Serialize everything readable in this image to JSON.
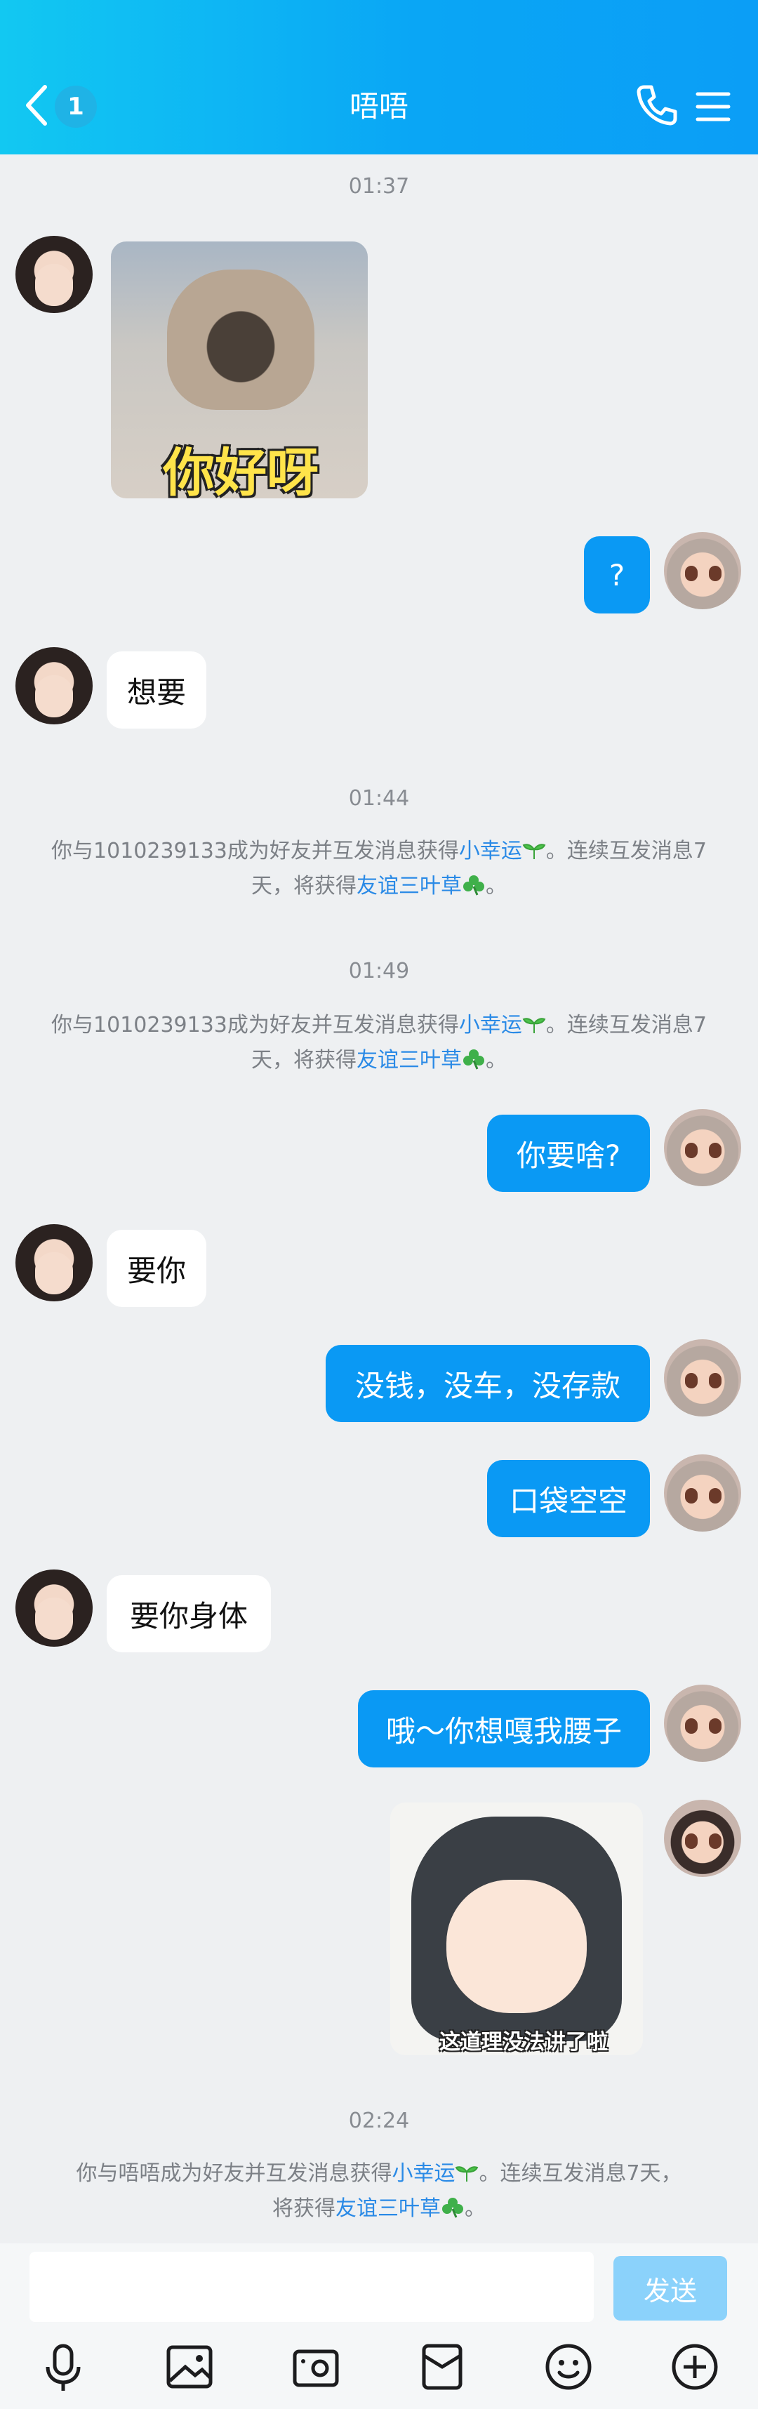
{
  "header": {
    "title": "唔唔",
    "unread_count": "1",
    "back_icon": "chevron-left-icon",
    "call_icon": "phone-icon",
    "menu_icon": "menu-icon"
  },
  "messages": [
    {
      "type": "time",
      "text": "01:37"
    },
    {
      "type": "sticker",
      "side": "left",
      "caption": "你好呀"
    },
    {
      "type": "text",
      "side": "right",
      "text": "?"
    },
    {
      "type": "text",
      "side": "left",
      "text": "想要"
    },
    {
      "type": "time",
      "text": "01:44"
    },
    {
      "type": "notice",
      "pre": "你与1010239133成为好友并互发消息获得",
      "link1": "小幸运",
      "mid": "。连续互发消息7天，将获得",
      "link2": "友谊三叶草",
      "post": "。"
    },
    {
      "type": "time",
      "text": "01:49"
    },
    {
      "type": "notice",
      "pre": "你与1010239133成为好友并互发消息获得",
      "link1": "小幸运",
      "mid": "。连续互发消息7天，将获得",
      "link2": "友谊三叶草",
      "post": "。"
    },
    {
      "type": "text",
      "side": "right",
      "text": "你要啥?"
    },
    {
      "type": "text",
      "side": "left",
      "text": "要你"
    },
    {
      "type": "text",
      "side": "right",
      "text": "没钱，没车，没存款"
    },
    {
      "type": "text",
      "side": "right",
      "text": "口袋空空"
    },
    {
      "type": "text",
      "side": "left",
      "text": "要你身体"
    },
    {
      "type": "text",
      "side": "right",
      "text": "哦～你想嘎我腰子"
    },
    {
      "type": "sticker",
      "side": "right",
      "caption": "这道理没法讲了啦"
    },
    {
      "type": "time",
      "text": "02:24"
    },
    {
      "type": "notice",
      "pre": "你与唔唔成为好友并互发消息获得",
      "link1": "小幸运",
      "mid": "。连续互发消息7天，",
      "line2": "将获得",
      "link2": "友谊三叶草",
      "post": "。"
    }
  ],
  "input": {
    "placeholder": "",
    "send_label": "发送"
  },
  "toolbar": [
    "microphone-icon",
    "image-icon",
    "camera-icon",
    "red-packet-icon",
    "emoji-icon",
    "plus-icon"
  ],
  "colors": {
    "header": "#0aa6f5",
    "bubble_right": "#0a99f4",
    "link": "#2a8ae6",
    "send_disabled": "#8bd2fb"
  }
}
